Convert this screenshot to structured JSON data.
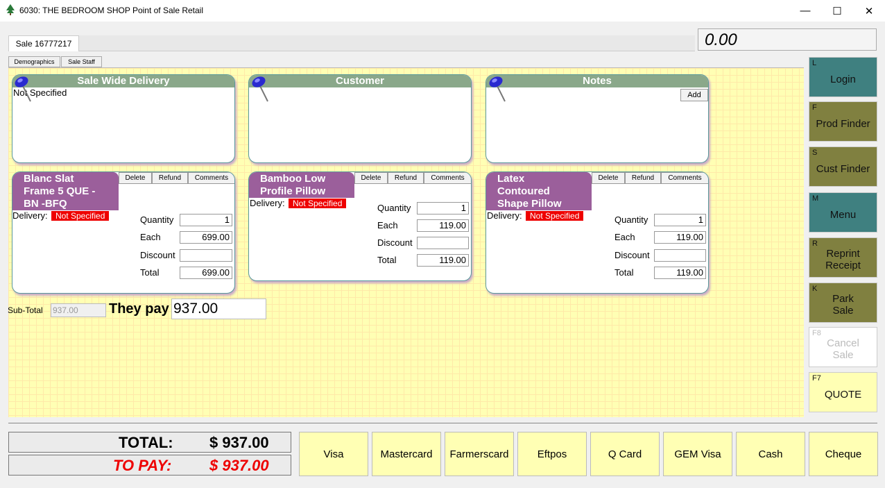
{
  "window": {
    "title": "6030: THE BEDROOM SHOP Point of Sale Retail"
  },
  "sale_tab": "Sale 16777217",
  "display_amount": "0.00",
  "subtabs": [
    "Demographics",
    "Sale Staff"
  ],
  "panels": {
    "delivery": {
      "title": "Sale Wide Delivery",
      "text": "Not Specified"
    },
    "customer": {
      "title": "Customer"
    },
    "notes": {
      "title": "Notes",
      "add_label": "Add"
    }
  },
  "item_buttons": [
    "Delete",
    "Refund",
    "Comments"
  ],
  "labels": {
    "delivery": "Delivery:",
    "quantity": "Quantity",
    "each": "Each",
    "discount": "Discount",
    "total": "Total"
  },
  "items": [
    {
      "title_lines": [
        "Blanc Slat",
        "Frame 5 QUE -",
        "BN -BFQ"
      ],
      "delivery": "Not Specified",
      "quantity": "1",
      "each": "699.00",
      "discount": "",
      "total": "699.00"
    },
    {
      "title_lines": [
        "Bamboo Low",
        "Profile Pillow"
      ],
      "delivery": "Not Specified",
      "quantity": "1",
      "each": "119.00",
      "discount": "",
      "total": "119.00"
    },
    {
      "title_lines": [
        "Latex",
        "Contoured",
        "Shape Pillow"
      ],
      "delivery": "Not Specified",
      "quantity": "1",
      "each": "119.00",
      "discount": "",
      "total": "119.00"
    }
  ],
  "subtotal": {
    "label": "Sub-Total",
    "value": "937.00",
    "they_pay_label": "They pay",
    "they_pay_value": "937.00"
  },
  "side_buttons": [
    {
      "key": "L",
      "label": "Login",
      "style": "teal"
    },
    {
      "key": "F",
      "label": "Prod Finder",
      "style": "olive"
    },
    {
      "key": "S",
      "label": "Cust Finder",
      "style": "olive"
    },
    {
      "key": "M",
      "label": "Menu",
      "style": "teal"
    },
    {
      "key": "R",
      "label": "Reprint Receipt",
      "style": "olive"
    },
    {
      "key": "K",
      "label": "Park Sale",
      "style": "olive"
    },
    {
      "key": "F8",
      "label": "Cancel Sale",
      "style": "disabled"
    },
    {
      "key": "F7",
      "label": "QUOTE",
      "style": "yellow"
    }
  ],
  "totals": {
    "total_label": "TOTAL:",
    "total_value": "$ 937.00",
    "topay_label": "TO PAY:",
    "topay_value": "$ 937.00"
  },
  "payment_methods": [
    "Visa",
    "Mastercard",
    "Farmerscard",
    "Eftpos",
    "Q Card",
    "GEM Visa",
    "Cash",
    "Cheque"
  ],
  "colors": {
    "panel_header": "#8aa88a",
    "item_title": "#9b5f9b",
    "badge": "#e00000",
    "grid_bg": "#ffffb4",
    "teal": "#3f8080",
    "olive": "#808040",
    "to_pay": "#e00000"
  }
}
